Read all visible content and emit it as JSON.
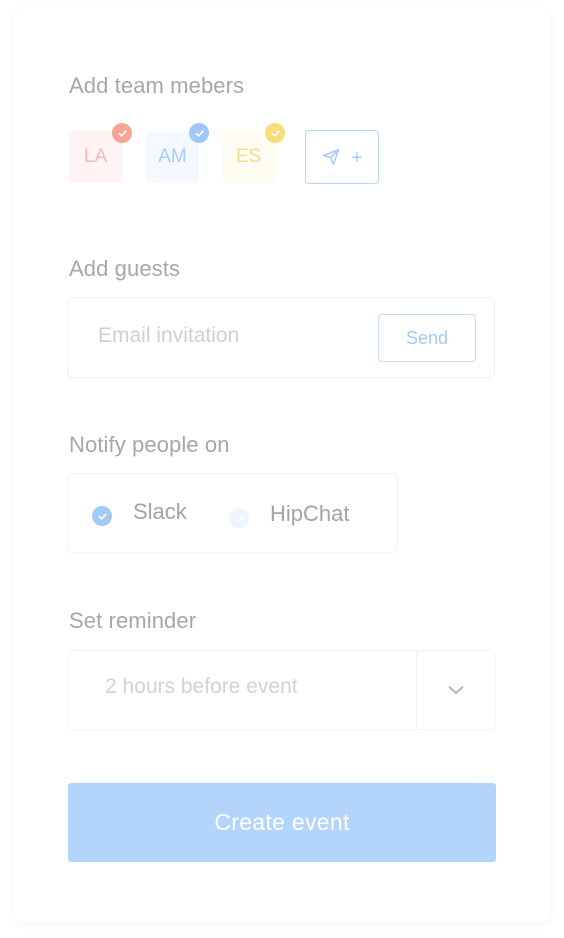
{
  "team": {
    "heading": "Add team mebers",
    "members": [
      {
        "initials": "LA",
        "text_color": "#f6b8ae",
        "bg_color": "#fff4f3",
        "badge_color": "#f7a497"
      },
      {
        "initials": "AM",
        "text_color": "#a9ccf6",
        "bg_color": "#f4f9ff",
        "badge_color": "#9fc8f7"
      },
      {
        "initials": "ES",
        "text_color": "#f6dc86",
        "bg_color": "#fffcf1",
        "badge_color": "#f8dd7a"
      }
    ],
    "invite_icon": "send-icon",
    "invite_plus": "+"
  },
  "guests": {
    "heading": "Add guests",
    "placeholder": "Email invitation",
    "send_label": "Send"
  },
  "notify": {
    "heading": "Notify people on",
    "options": [
      {
        "label": "Slack",
        "selected": true
      },
      {
        "label": "HipChat",
        "selected": false
      }
    ]
  },
  "reminder": {
    "heading": "Set reminder",
    "selected_value": "2 hours before event",
    "dropdown_icon": "chevron-down-icon"
  },
  "create_label": "Create event",
  "colors": {
    "accent": "#b4d5fb",
    "label_text": "#a7a7a7"
  }
}
